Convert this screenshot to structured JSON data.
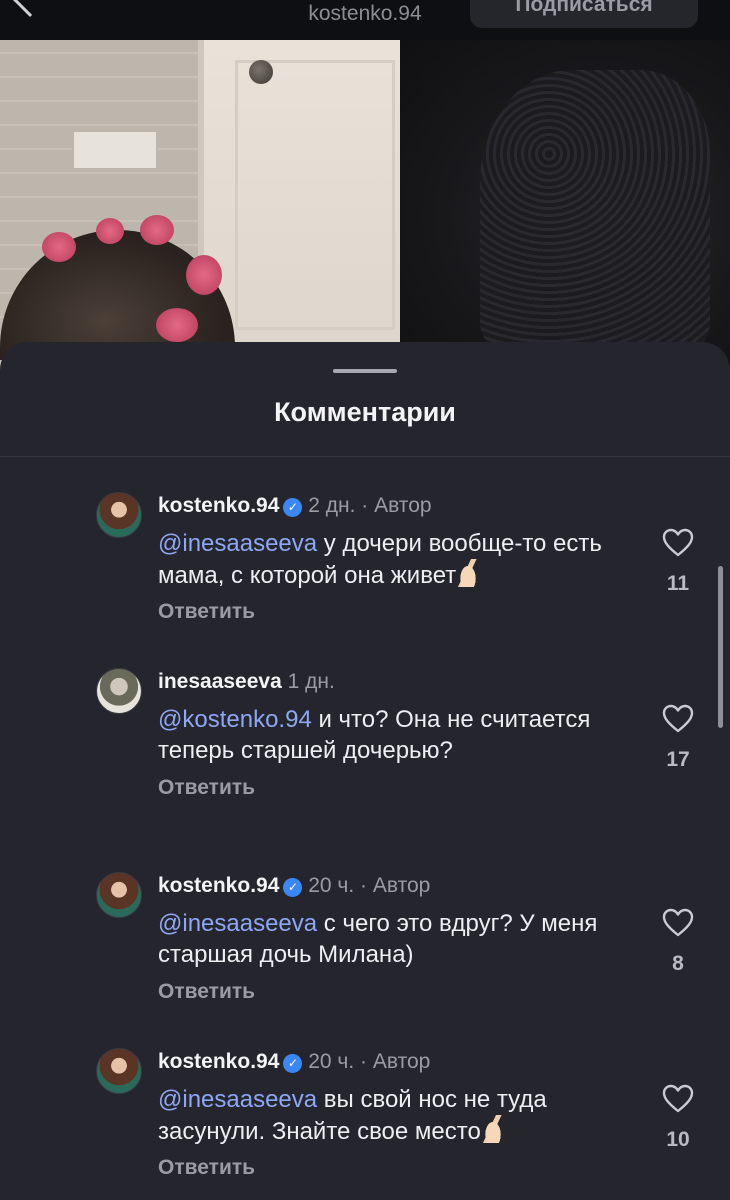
{
  "header": {
    "profile_name": "kostenko.94",
    "follow_label": "Подписаться"
  },
  "sheet": {
    "title": "Комментарии"
  },
  "comments": [
    {
      "user": "kostenko.94",
      "verified": true,
      "time": "2 дн.",
      "author_tag": "· Автор",
      "mention": "@inesaaseeva",
      "text": " у дочери вообще-то есть мама, с которой она живет",
      "emoji": "crossed-fingers",
      "likes": "11",
      "reply_label": "Ответить"
    },
    {
      "user": "inesaaseeva",
      "verified": false,
      "time": "1 дн.",
      "author_tag": "",
      "mention": "@kostenko.94",
      "text": " и что? Она не считается теперь старшей дочерью?",
      "emoji": "",
      "likes": "17",
      "reply_label": "Ответить"
    },
    {
      "user": "kostenko.94",
      "verified": true,
      "time": "20 ч.",
      "author_tag": "· Автор",
      "mention": "@inesaaseeva",
      "text": " с чего это вдруг? У меня старшая дочь Милана)",
      "emoji": "",
      "likes": "8",
      "reply_label": "Ответить"
    },
    {
      "user": "kostenko.94",
      "verified": true,
      "time": "20 ч.",
      "author_tag": "· Автор",
      "mention": "@inesaaseeva",
      "text": " вы свой нос не туда засунули. Знайте свое место",
      "emoji": "crossed-fingers",
      "likes": "10",
      "reply_label": "Ответить"
    }
  ]
}
